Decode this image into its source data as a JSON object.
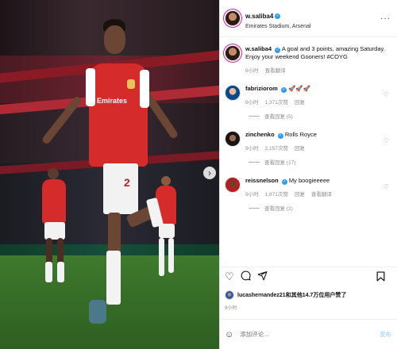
{
  "post_header": {
    "username": "w.saliba4",
    "location": "Emirates Stadium, Arsenal"
  },
  "photo": {
    "shirt_sponsor": "Emirates",
    "shirt_number": "2",
    "next_icon": "chevron-right-icon"
  },
  "caption": {
    "username": "w.saliba4",
    "text": "A goal and 3 points, amazing Saturday. Enjoy your weekend Gooners! #COYG",
    "time": "9小时",
    "translate": "查看翻译"
  },
  "comments": [
    {
      "username": "fabriziorom",
      "text": "🚀🚀🚀",
      "time": "9小时",
      "likes": "1,371次赞",
      "reply": "回复",
      "view_replies": "查看回复 (5)"
    },
    {
      "username": "zinchenko",
      "text": "Rolls Royce",
      "time": "9小时",
      "likes": "2,157次赞",
      "reply": "回复",
      "view_replies": "查看回复 (17)"
    },
    {
      "username": "reissnelson",
      "text": "My boogieeeee",
      "time": "9小时",
      "likes": "1,871次赞",
      "reply": "回复",
      "translate": "查看翻译",
      "view_replies": "查看回复 (2)"
    }
  ],
  "actions": {
    "like_icon": "heart-icon",
    "comment_icon": "comment-icon",
    "share_icon": "send-icon",
    "save_icon": "bookmark-icon"
  },
  "likes_line": {
    "user": "lucashernandez21",
    "text": "lucashernandez21和其他14.7万位用户赞了"
  },
  "post_time": "9小时",
  "add_comment": {
    "placeholder": "添加评论...",
    "post_label": "发布"
  },
  "colors": {
    "verified": "#2a9df4",
    "arsenal_red": "#d62b2b",
    "post_disabled": "#b3dbff"
  }
}
